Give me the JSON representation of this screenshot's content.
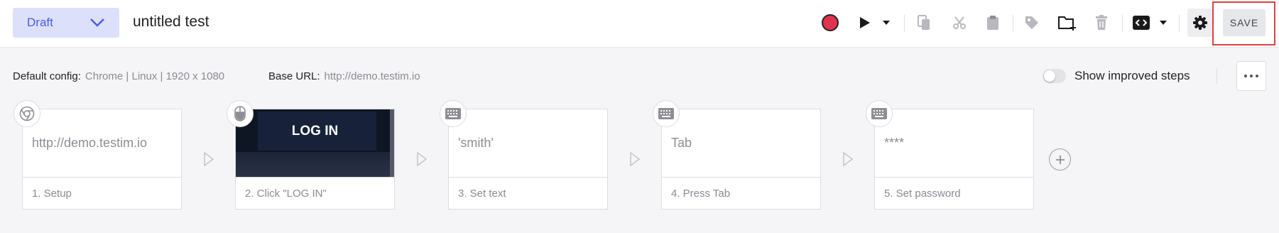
{
  "header": {
    "status": "Draft",
    "test_name": "untitled test",
    "save_label": "SAVE"
  },
  "config": {
    "default_config_label": "Default config:",
    "default_config_value": "Chrome | Linux | 1920 x 1080",
    "base_url_label": "Base URL:",
    "base_url_value": "http://demo.testim.io",
    "improved_steps_label": "Show improved steps",
    "improved_steps_on": false
  },
  "steps": [
    {
      "title": "1. Setup",
      "content": "http://demo.testim.io",
      "icon": "chrome-icon"
    },
    {
      "title": "2. Click \"LOG IN\"",
      "content": "LOG IN",
      "icon": "mouse-icon"
    },
    {
      "title": "3. Set text",
      "content": "'smith'",
      "icon": "keyboard-icon"
    },
    {
      "title": "4. Press Tab",
      "content": "Tab",
      "icon": "keyboard-icon"
    },
    {
      "title": "5. Set password",
      "content": "****",
      "icon": "keyboard-icon"
    }
  ],
  "colors": {
    "accent": "#4a5ce8",
    "record": "#e0334d",
    "highlight": "#e04040"
  }
}
